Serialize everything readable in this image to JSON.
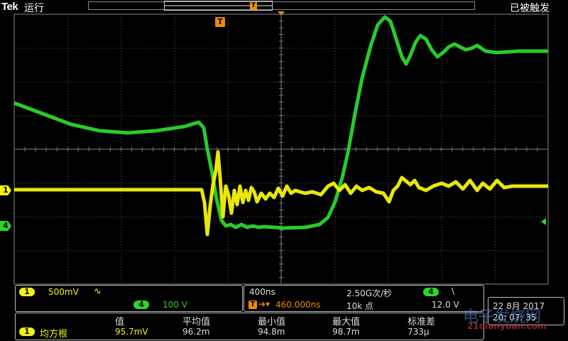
{
  "topbar": {
    "brand": "Tek",
    "run_status": "运行",
    "trigger_status": "已被触发",
    "record_marker": "T"
  },
  "screen": {
    "trigger_marker": "T",
    "ch1_marker": "1",
    "ch4_marker": "4"
  },
  "channels": {
    "ch1": {
      "badge": "1",
      "scale": "500mV",
      "coupling_symbol": "∿",
      "color": "#f4f20c"
    },
    "ch4": {
      "badge": "4",
      "scale": "100 V",
      "color": "#2bd62b"
    }
  },
  "timebase": {
    "scale": "400ns",
    "sample_rate": "2.50G次/秒",
    "trigger_position": "460.000ns",
    "record_length": "10k 点",
    "trigger_source": "4",
    "trigger_slope": "\\",
    "trigger_level": "12.0 V"
  },
  "measurement": {
    "channel_badge": "1",
    "name": "均方根",
    "headers": [
      "值",
      "平均值",
      "最小值",
      "最大值",
      "标准差"
    ],
    "values": [
      "95.7mV",
      "96.2m",
      "94.8m",
      "98.7m",
      "733µ"
    ]
  },
  "datetime": {
    "date": "22 8月 2017",
    "time": "20: 07: 35"
  },
  "watermark": {
    "text": "电子发烧网",
    "sub": "21dianyuan.com"
  },
  "colors": {
    "ch1": "#f4f20c",
    "ch4": "#2bd62b",
    "trigger": "#f28a00",
    "background": "#000000",
    "grid": "#7a7a7a"
  }
}
